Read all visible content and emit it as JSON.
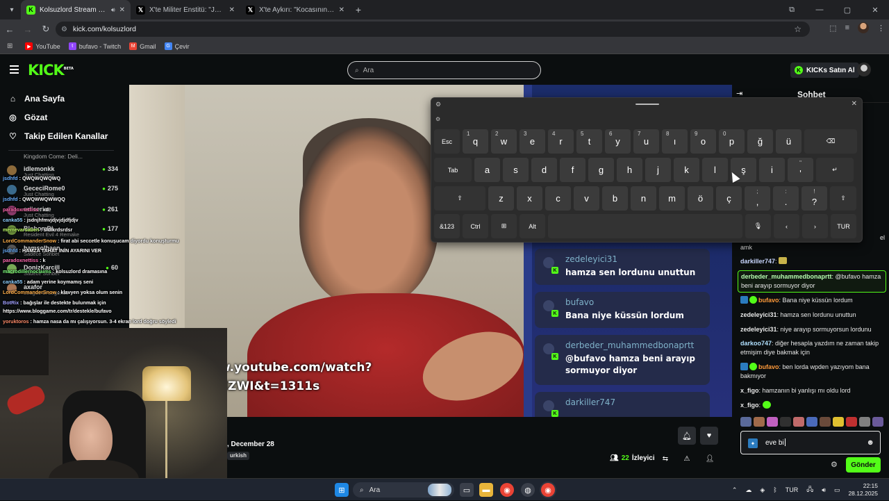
{
  "browser": {
    "tabs": [
      {
        "title": "Kolsuzlord Stream - Watch Live on Kick",
        "icon": "kick-icon"
      },
      {
        "title": "X'te Militer Enstitü: \"Japonya, Türk",
        "icon": "x-icon"
      },
      {
        "title": "X'te Aykırı: \"Kocasının cezaevinde",
        "icon": "x-icon"
      }
    ],
    "url": "kick.com/kolsuzlord",
    "bookmarks": [
      {
        "label": "YouTube",
        "color": "#ff0000"
      },
      {
        "label": "bufavo - Twitch",
        "color": "#9146ff"
      },
      {
        "label": "Gmail",
        "color": "#ea4335"
      },
      {
        "label": "Çevir",
        "color": "#4285f4"
      }
    ]
  },
  "header": {
    "logo": "KICK",
    "logo_badge": "BETA",
    "search_placeholder": "Ara",
    "buy_kicks": "KICKs Satın Al"
  },
  "sidebar": {
    "nav": [
      {
        "label": "Ana Sayfa",
        "icon": "home-icon"
      },
      {
        "label": "Gözat",
        "icon": "compass-icon"
      },
      {
        "label": "Takip Edilen Kanallar",
        "icon": "heart-icon"
      }
    ],
    "first_sub": "Kingdom Come: Deli...",
    "channels": [
      {
        "name": "idlemonkk",
        "viewers": "334",
        "sub": "Just Chatting",
        "color": "#8c6a3a"
      },
      {
        "name": "GececiRome0",
        "viewers": "275",
        "sub": "Just Chatting",
        "color": "#3a6a8c"
      },
      {
        "name": "erliseriae",
        "viewers": "261",
        "sub": "Just Chatting",
        "color": "#8c3a6a"
      },
      {
        "name": "BlobomBl",
        "viewers": "177",
        "sub": "Resident Evil 4 Remake",
        "color": "#6a8c3a"
      },
      {
        "name": "hamsolbaen",
        "viewers": "",
        "sub": "Sadece Sohbet",
        "color": "#555"
      },
      {
        "name": "DonizKarcill",
        "viewers": "60",
        "sub": "Sadece Sohbet",
        "color": "#7a5"
      },
      {
        "name": "axafor",
        "viewers": "",
        "sub": "League of Legends",
        "color": "#a75"
      }
    ]
  },
  "overlay_chat": [
    {
      "user": "jsdhfd",
      "text": ": QWQWQWQWQ",
      "color": "#6ab0ff"
    },
    {
      "user": "jsdhfd",
      "text": ": QWQWWQWWQQ",
      "color": "#6ab0ff"
    },
    {
      "user": "paradoxnettiss",
      "text": ": xd",
      "color": "#ff6ab0"
    },
    {
      "user": "canka55",
      "text": ": jsdnjhfmvjdjvjdjdfjdjv",
      "color": "#8fd0ff"
    },
    {
      "user": "memevarsaben",
      "text": ": sldlkrdsrdsr",
      "color": "#c0ff6a"
    },
    {
      "user": "LordCommanderSnow",
      "text": ": firat abi seccetle konuşucam diyordu konuşturmu",
      "color": "#ffb04a"
    },
    {
      "user": "jsdhfd",
      "text": ": HAMZA TAHAT İNİN AYARINI VER",
      "color": "#6ab0ff"
    },
    {
      "user": "paradoxnettiss",
      "text": ": k",
      "color": "#ff6ab0"
    },
    {
      "user": "macrodillernoclaims",
      "text": ": kolsuzlord dramasına",
      "color": "#7fff7f"
    },
    {
      "user": "canka55",
      "text": ": adam yerine koymamış seni",
      "color": "#8fd0ff"
    },
    {
      "user": "LordCommanderSnow",
      "text": ": klavyen yoksa olum senin",
      "color": "#ffb04a"
    },
    {
      "user": "BotRix",
      "text": ": bağışlar ile destekte bulunmak için",
      "color": "#a0a0ff"
    },
    {
      "user": "https://www.bloggame.com/tr/destekle/bufavo",
      "text": "",
      "color": "#ffffff"
    },
    {
      "user": "yoruktoros",
      "text": ": hamza nasa da mı çalışıyorsun. 3-4 ekran lord doğru söyledi",
      "color": "#ff8c6a"
    }
  ],
  "stream": {
    "video_overlay_lines": [
      "w.youtube.com/watch?",
      "dZWI&t=1311s"
    ],
    "date": ", December 28",
    "tag": "urkish",
    "viewers_count": "22",
    "viewers_label": "İzleyici",
    "cards": [
      {
        "user": "zedeleyici31",
        "text": "hamza sen lordunu unuttun"
      },
      {
        "user": "bufavo",
        "text": "Bana niye küssün lordum"
      },
      {
        "user": "derbeder_muhammedbonaprtt",
        "text": "@bufavo hamza beni arayıp sormuyor diyor"
      },
      {
        "user": "darkiller747",
        "text": ""
      }
    ]
  },
  "chat": {
    "title": "Sohbet",
    "partial_top": "el",
    "messages": [
      {
        "user": "",
        "text": "amk",
        "color": "#ffffff"
      },
      {
        "user": "darkiller747",
        "text": ":",
        "color": "#c9d6ff"
      },
      {
        "user": "derbeder_muhammedbonaprtt",
        "text": ": @bufavo hamza beni arayıp sormuyor diyor",
        "color": "#b6ffb0"
      },
      {
        "user": "bufavo",
        "text": ": Bana niye küssün lordum",
        "color": "#ff9a3a"
      },
      {
        "user": "zedeleyici31",
        "text": ": hamza sen lordunu unuttun",
        "color": "#ffffff"
      },
      {
        "user": "zedeleyici31",
        "text": ": niye arayıp sormuyorsun lordunu",
        "color": "#ffffff"
      },
      {
        "user": "darkoo747",
        "text": ": diğer hesapla yazdım ne zaman takip etmişim diye bakmak için",
        "color": "#b0e0ff"
      },
      {
        "user": "bufavo",
        "text": ": ben lorda wpden yazıyom bana bakmıyor",
        "color": "#ff9a3a"
      },
      {
        "user": "x_figo",
        "text": ": hamzanın bi yanlışı mı oldu lord",
        "color": "#ffffff"
      },
      {
        "user": "x_figo",
        "text": ":",
        "color": "#ffffff"
      }
    ],
    "input_value": "eve bi",
    "send_label": "Gönder"
  },
  "keyboard": {
    "row1": [
      {
        "k": "Esc"
      },
      {
        "k": "q",
        "h": "1"
      },
      {
        "k": "w",
        "h": "2"
      },
      {
        "k": "e",
        "h": "3"
      },
      {
        "k": "r",
        "h": "4"
      },
      {
        "k": "t",
        "h": "5"
      },
      {
        "k": "y",
        "h": "6"
      },
      {
        "k": "u",
        "h": "7"
      },
      {
        "k": "ı",
        "h": "8"
      },
      {
        "k": "o",
        "h": "9"
      },
      {
        "k": "p",
        "h": "0"
      },
      {
        "k": "ğ"
      },
      {
        "k": "ü"
      },
      {
        "k": "⌫"
      }
    ],
    "row2": [
      {
        "k": "Tab"
      },
      {
        "k": "a"
      },
      {
        "k": "s"
      },
      {
        "k": "d"
      },
      {
        "k": "f"
      },
      {
        "k": "g"
      },
      {
        "k": "h"
      },
      {
        "k": "j"
      },
      {
        "k": "k"
      },
      {
        "k": "l"
      },
      {
        "k": "ş"
      },
      {
        "k": "i"
      },
      {
        "k": "'",
        "u": "\""
      },
      {
        "k": "↵"
      }
    ],
    "row3": [
      {
        "k": "⇧"
      },
      {
        "k": "z"
      },
      {
        "k": "x"
      },
      {
        "k": "c"
      },
      {
        "k": "v"
      },
      {
        "k": "b"
      },
      {
        "k": "n"
      },
      {
        "k": "m"
      },
      {
        "k": "ö"
      },
      {
        "k": "ç"
      },
      {
        "k": ",",
        "u": ";"
      },
      {
        "k": ".",
        "u": ":"
      },
      {
        "k": "?",
        "u": "!"
      },
      {
        "k": "⇧"
      }
    ],
    "row4": [
      {
        "k": "&123"
      },
      {
        "k": "Ctrl"
      },
      {
        "k": "⊞"
      },
      {
        "k": "Alt"
      },
      {
        "k": ""
      },
      {
        "k": "🎙"
      },
      {
        "k": "‹"
      },
      {
        "k": "›"
      },
      {
        "k": "TUR"
      }
    ]
  },
  "taskbar": {
    "search_label": "Ara",
    "lang": "TUR",
    "time": "22:15",
    "date": "28.12.2025"
  }
}
